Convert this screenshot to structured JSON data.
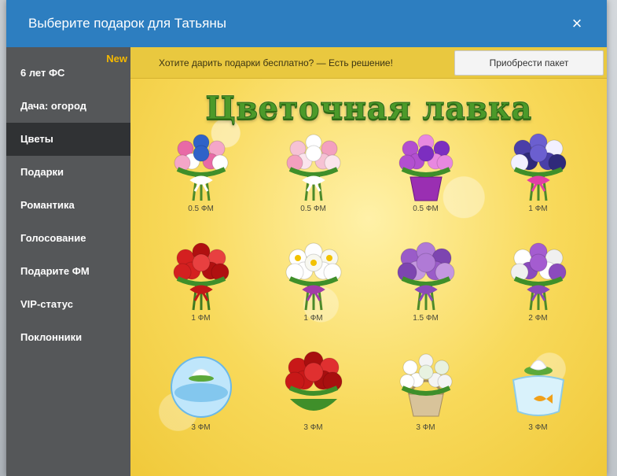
{
  "dialog": {
    "title": "Выберите подарок для Татьяны",
    "close_label": "×"
  },
  "sidebar": {
    "new_badge": "New",
    "items": [
      {
        "label": "6 лет ФС",
        "active": false
      },
      {
        "label": "Дача: огород",
        "active": false
      },
      {
        "label": "Цветы",
        "active": true
      },
      {
        "label": "Подарки",
        "active": false
      },
      {
        "label": "Романтика",
        "active": false
      },
      {
        "label": "Голосование",
        "active": false
      },
      {
        "label": "Подарите ФМ",
        "active": false
      },
      {
        "label": "VIP-статус",
        "active": false
      },
      {
        "label": "Поклонники",
        "active": false
      }
    ]
  },
  "promo": {
    "text": "Хотите дарить подарки бесплатно? — Есть решение!",
    "button_label": "Приобрести пакет"
  },
  "shop": {
    "title": "Цветочная лавка",
    "gifts": [
      {
        "icon": "pink-rose-bouquet-icon",
        "price": "0.5 ФМ"
      },
      {
        "icon": "white-pink-rose-bouquet-icon",
        "price": "0.5 ФМ"
      },
      {
        "icon": "potted-violets-icon",
        "price": "0.5 ФМ"
      },
      {
        "icon": "pansy-bouquet-icon",
        "price": "1 ФМ"
      },
      {
        "icon": "red-rose-bouquet-icon",
        "price": "1 ФМ"
      },
      {
        "icon": "daisy-bouquet-icon",
        "price": "1 ФМ"
      },
      {
        "icon": "lilac-bouquet-icon",
        "price": "1.5 ФМ"
      },
      {
        "icon": "tulip-lilac-bouquet-icon",
        "price": "2 ФМ"
      },
      {
        "icon": "water-lily-bowl-icon",
        "price": "3 ФМ"
      },
      {
        "icon": "red-anthurium-bouquet-icon",
        "price": "3 ФМ"
      },
      {
        "icon": "tulip-basket-icon",
        "price": "3 ФМ"
      },
      {
        "icon": "goldfish-lotus-bowl-icon",
        "price": "3 ФМ"
      }
    ]
  },
  "colors": {
    "header": "#2d7ec0",
    "sidebar": "#555759",
    "sidebar_active": "#303234",
    "new_badge": "#f5b800",
    "promo_bar": "#e9c83f",
    "title_green": "#4c9a2a"
  }
}
